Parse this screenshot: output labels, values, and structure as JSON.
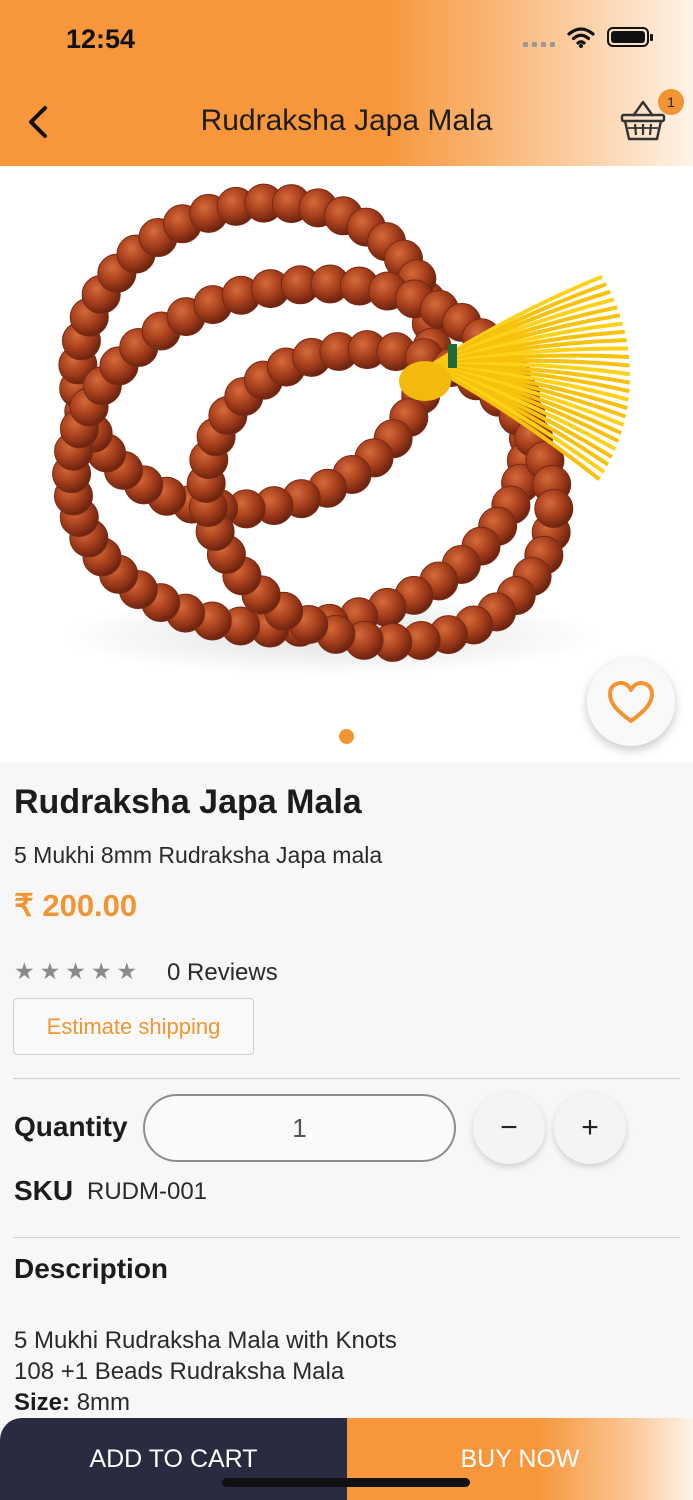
{
  "status_bar": {
    "time": "12:54"
  },
  "header": {
    "title": "Rudraksha Japa Mala",
    "cart_count": "1"
  },
  "product": {
    "name": "Rudraksha Japa Mala",
    "subtitle": "5 Mukhi 8mm Rudraksha Japa mala",
    "price": "₹ 200.00",
    "rating": 0,
    "reviews_label": "0 Reviews",
    "image_pages": 1,
    "current_image": 1
  },
  "shipping": {
    "button_label": "Estimate shipping"
  },
  "quantity": {
    "label": "Quantity",
    "value": "1",
    "decrease_label": "−",
    "increase_label": "+"
  },
  "sku": {
    "label": "SKU",
    "value": "RUDM-001"
  },
  "description": {
    "title": "Description",
    "line1": "5 Mukhi Rudraksha Mala with Knots",
    "line2": "108 +1 Beads Rudraksha Mala",
    "size_label": "Size:",
    "size_value": "8mm"
  },
  "actions": {
    "add_to_cart": "ADD TO CART",
    "buy_now": "BUY NOW"
  },
  "colors": {
    "accent": "#f29431",
    "dark": "#292b40"
  }
}
